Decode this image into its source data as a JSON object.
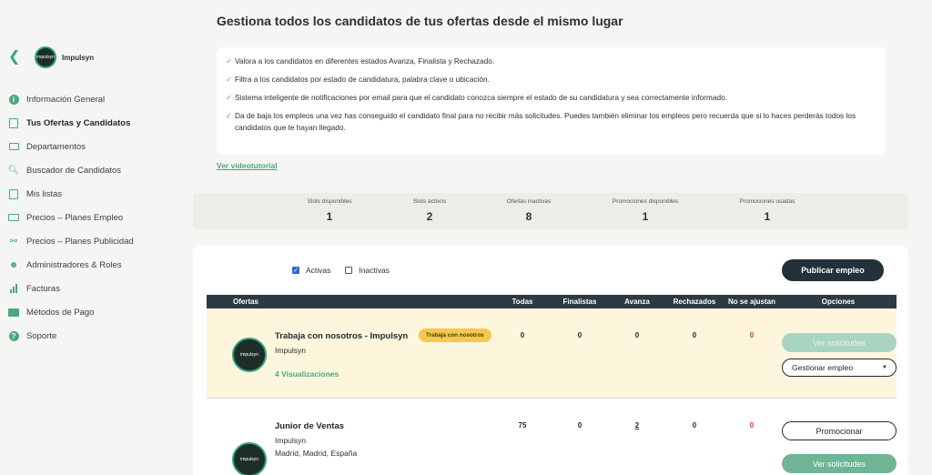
{
  "sidebar": {
    "company_name": "Impulsyn",
    "logo_text": "impulsyn",
    "menu": [
      {
        "label": "Información General",
        "icon": "info-icon"
      },
      {
        "label": "Tus Ofertas y Candidatos",
        "icon": "document-icon",
        "active": true
      },
      {
        "label": "Departamentos",
        "icon": "inbox-icon"
      },
      {
        "label": "Buscador de Candidatos",
        "icon": "search-icon"
      },
      {
        "label": "Mis listas",
        "icon": "clipboard-icon"
      },
      {
        "label": "Precios – Planes Empleo",
        "icon": "money-icon"
      },
      {
        "label": "Precios – Planes Publicidad",
        "icon": "microphone-icon"
      },
      {
        "label": "Administradores & Roles",
        "icon": "user-icon"
      },
      {
        "label": "Facturas",
        "icon": "chart-bars-icon"
      },
      {
        "label": "Métodos de Pago",
        "icon": "credit-card-icon"
      },
      {
        "label": "Soporte",
        "icon": "help-icon"
      }
    ]
  },
  "header": {
    "title": "Gestiona todos los candidatos de tus ofertas desde el mismo lugar",
    "info": [
      "Valora a los candidatos en diferentes estados Avanza, Finalista y Rechazado.",
      "Filtra a los candidatos por estado de candidatura, palabra clave o ubicación.",
      "Sistema inteligente de notificaciones por email para que el candidato conozca siempre el estado de su candidatura y sea correctamente informado.",
      "Da de baja los empleos una vez has conseguido el candidato final para no recibir más solicitudes. Puedes también eliminar los empleos pero recuerda que si lo haces perderás todos los candidatos que te hayan llegado."
    ],
    "tutorial_link": "Ver videotutorial"
  },
  "stats": [
    {
      "label": "Slots disponibles",
      "value": "1"
    },
    {
      "label": "Slots activos",
      "value": "2"
    },
    {
      "label": "Ofertas inactivas",
      "value": "8"
    },
    {
      "label": "Promociones disponibles",
      "value": "1"
    },
    {
      "label": "Promociones usadas",
      "value": "1"
    }
  ],
  "filters": {
    "active_label": "Activas",
    "inactive_label": "Inactivas"
  },
  "publish_button": "Publicar empleo",
  "table": {
    "columns": [
      "Ofertas",
      "Todas",
      "Finalistas",
      "Avanza",
      "Rechazados",
      "No se ajustan",
      "Opciones"
    ],
    "rows": [
      {
        "title": "Trabaja con nosotros - Impulsyn",
        "tag": "Trabaja con nosotros",
        "company": "Impulsyn",
        "views": "4 Visualizaciones",
        "todas": "0",
        "finalistas": "0",
        "avanza": "0",
        "rechazados": "0",
        "no_ajustan": "0",
        "btn_primary": "Ver solicitudes",
        "select_value": "Gestionar empleo"
      },
      {
        "title": "Junior de Ventas",
        "company": "Impulsyn",
        "location": "Madrid, Madrid, España",
        "todas": "75",
        "finalistas": "0",
        "avanza": "2",
        "rechazados": "0",
        "no_ajustan": "0",
        "btn_promote": "Promocionar",
        "btn_primary": "Ver solicitudes"
      }
    ]
  },
  "colors": {
    "accent": "#47a97f",
    "dark": "#22313a",
    "highlight_row": "#fdf6dd",
    "tag": "#f3c94f",
    "alert": "#d8322f"
  }
}
